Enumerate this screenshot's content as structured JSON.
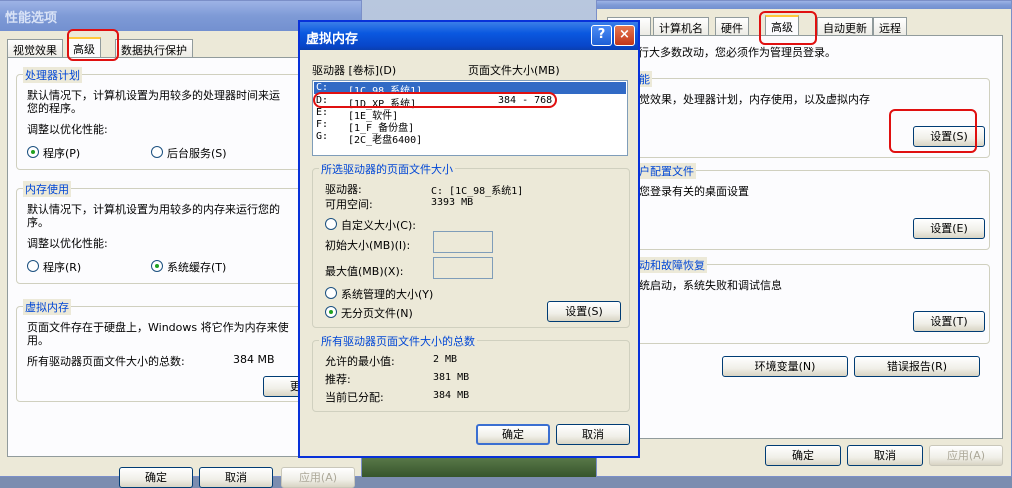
{
  "left_dialog": {
    "title": "性能选项",
    "tabs": [
      "视觉效果",
      "高级",
      "数据执行保护"
    ],
    "cpu": {
      "legend": "处理器计划",
      "desc1": "默认情况下，计算机设置为用较多的处理器时间来运",
      "desc2": "您的程序。",
      "adjust": "调整以优化性能:",
      "opt_programs": "程序(P)",
      "opt_background": "后台服务(S)"
    },
    "mem": {
      "legend": "内存使用",
      "desc1": "默认情况下，计算机设置为用较多的内存来运行您的",
      "desc2": "序。",
      "adjust": "调整以优化性能:",
      "opt_programs": "程序(R)",
      "opt_cache": "系统缓存(T)"
    },
    "vm": {
      "legend": "虚拟内存",
      "desc1": "页面文件存在于硬盘上，Windows 将它作为内存来使",
      "desc2": "用。",
      "total_label": "所有驱动器页面文件大小的总数:",
      "total_value": "384 MB",
      "change_button": "更改("
    },
    "ok": "确定",
    "cancel": "取消",
    "apply": "应用(A)"
  },
  "right_dialog": {
    "tabs": [
      "计算机名",
      "硬件",
      "高级",
      "自动更新",
      "远程"
    ],
    "note": "行大多数改动，您必须作为管理员登录。",
    "perf": {
      "legend": "能",
      "desc": "觉效果，处理器计划，内存使用，以及虚拟内存",
      "button": "设置(S)"
    },
    "profile": {
      "legend": "户配置文件",
      "desc": "您登录有关的桌面设置",
      "button": "设置(E)"
    },
    "startup": {
      "legend": "动和故障恢复",
      "desc": "统启动，系统失败和调试信息",
      "button": "设置(T)"
    },
    "env_button": "环境变量(N)",
    "error_button": "错误报告(R)",
    "ok": "确定",
    "cancel": "取消",
    "apply": "应用(A)"
  },
  "vm_dialog": {
    "title": "虚拟内存",
    "help_glyph": "?",
    "close_glyph": "×",
    "col_drive": "驱动器 [卷标](D)",
    "col_size": "页面文件大小(MB)",
    "drives": [
      {
        "letter": "C:",
        "label": "[1C_98_系统1]",
        "size": ""
      },
      {
        "letter": "D:",
        "label": "[1D_XP_系统]",
        "size": "384 - 768"
      },
      {
        "letter": "E:",
        "label": "[1E_软件]",
        "size": ""
      },
      {
        "letter": "F:",
        "label": "[1_F_备份盘]",
        "size": ""
      },
      {
        "letter": "G:",
        "label": "[2C_老盘6400]",
        "size": ""
      }
    ],
    "selected": {
      "legend": "所选驱动器的页面文件大小",
      "drive_label": "驱动器:",
      "drive_value": "C:  [1C_98_系统1]",
      "space_label": "可用空间:",
      "space_value": "3393 MB",
      "custom": "自定义大小(C):",
      "initial": "初始大小(MB)(I):",
      "max": "最大值(MB)(X):",
      "system": "系统管理的大小(Y)",
      "none": "无分页文件(N)",
      "set_button": "设置(S)"
    },
    "totals": {
      "legend": "所有驱动器页面文件大小的总数",
      "min_label": "允许的最小值:",
      "min_value": "2 MB",
      "rec_label": "推荐:",
      "rec_value": "381 MB",
      "cur_label": "当前已分配:",
      "cur_value": "384 MB"
    },
    "ok": "确定",
    "cancel": "取消"
  }
}
